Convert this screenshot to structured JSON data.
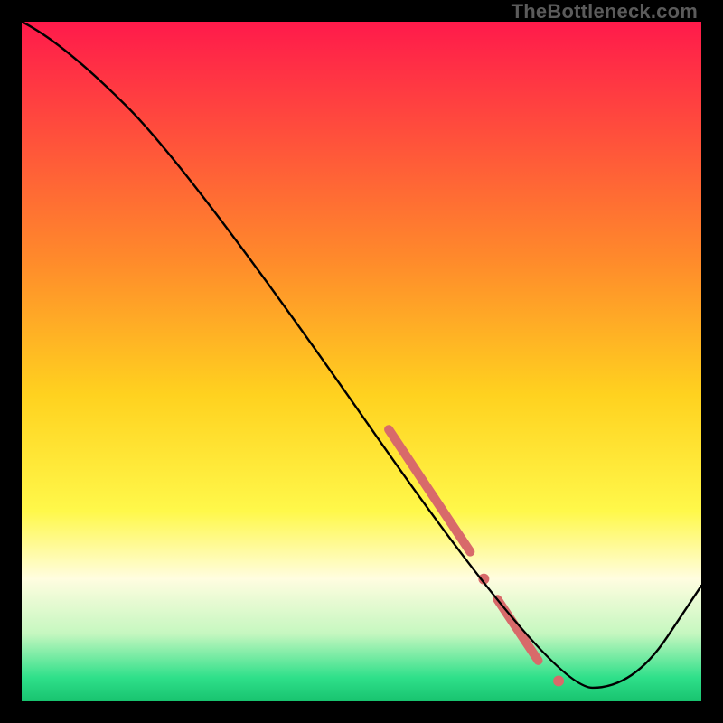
{
  "watermark": "TheBottleneck.com",
  "chart_data": {
    "type": "line",
    "title": "",
    "xlabel": "",
    "ylabel": "",
    "xlim": [
      0,
      100
    ],
    "ylim": [
      0,
      100
    ],
    "grid": false,
    "legend": false,
    "series": [
      {
        "name": "bottleneck-curve",
        "x": [
          0,
          6,
          25,
          78,
          90,
          100
        ],
        "y": [
          100,
          97,
          78,
          2,
          2,
          17
        ]
      }
    ],
    "highlight_segments": [
      {
        "x0": 54,
        "y0": 40,
        "x1": 66,
        "y1": 22,
        "thickness": 10
      },
      {
        "x0": 70,
        "y0": 15,
        "x1": 76,
        "y1": 6,
        "thickness": 10
      }
    ],
    "highlight_dots": [
      {
        "x": 68,
        "y": 18,
        "r": 6
      },
      {
        "x": 79,
        "y": 3,
        "r": 6
      }
    ],
    "background_gradient": {
      "stops": [
        {
          "offset": 0.0,
          "color": "#ff1a4b"
        },
        {
          "offset": 0.35,
          "color": "#ff8a2b"
        },
        {
          "offset": 0.55,
          "color": "#ffd21f"
        },
        {
          "offset": 0.72,
          "color": "#fff84a"
        },
        {
          "offset": 0.82,
          "color": "#fffde0"
        },
        {
          "offset": 0.9,
          "color": "#c6f7c0"
        },
        {
          "offset": 0.965,
          "color": "#2fe08a"
        },
        {
          "offset": 1.0,
          "color": "#18c36f"
        }
      ]
    }
  }
}
